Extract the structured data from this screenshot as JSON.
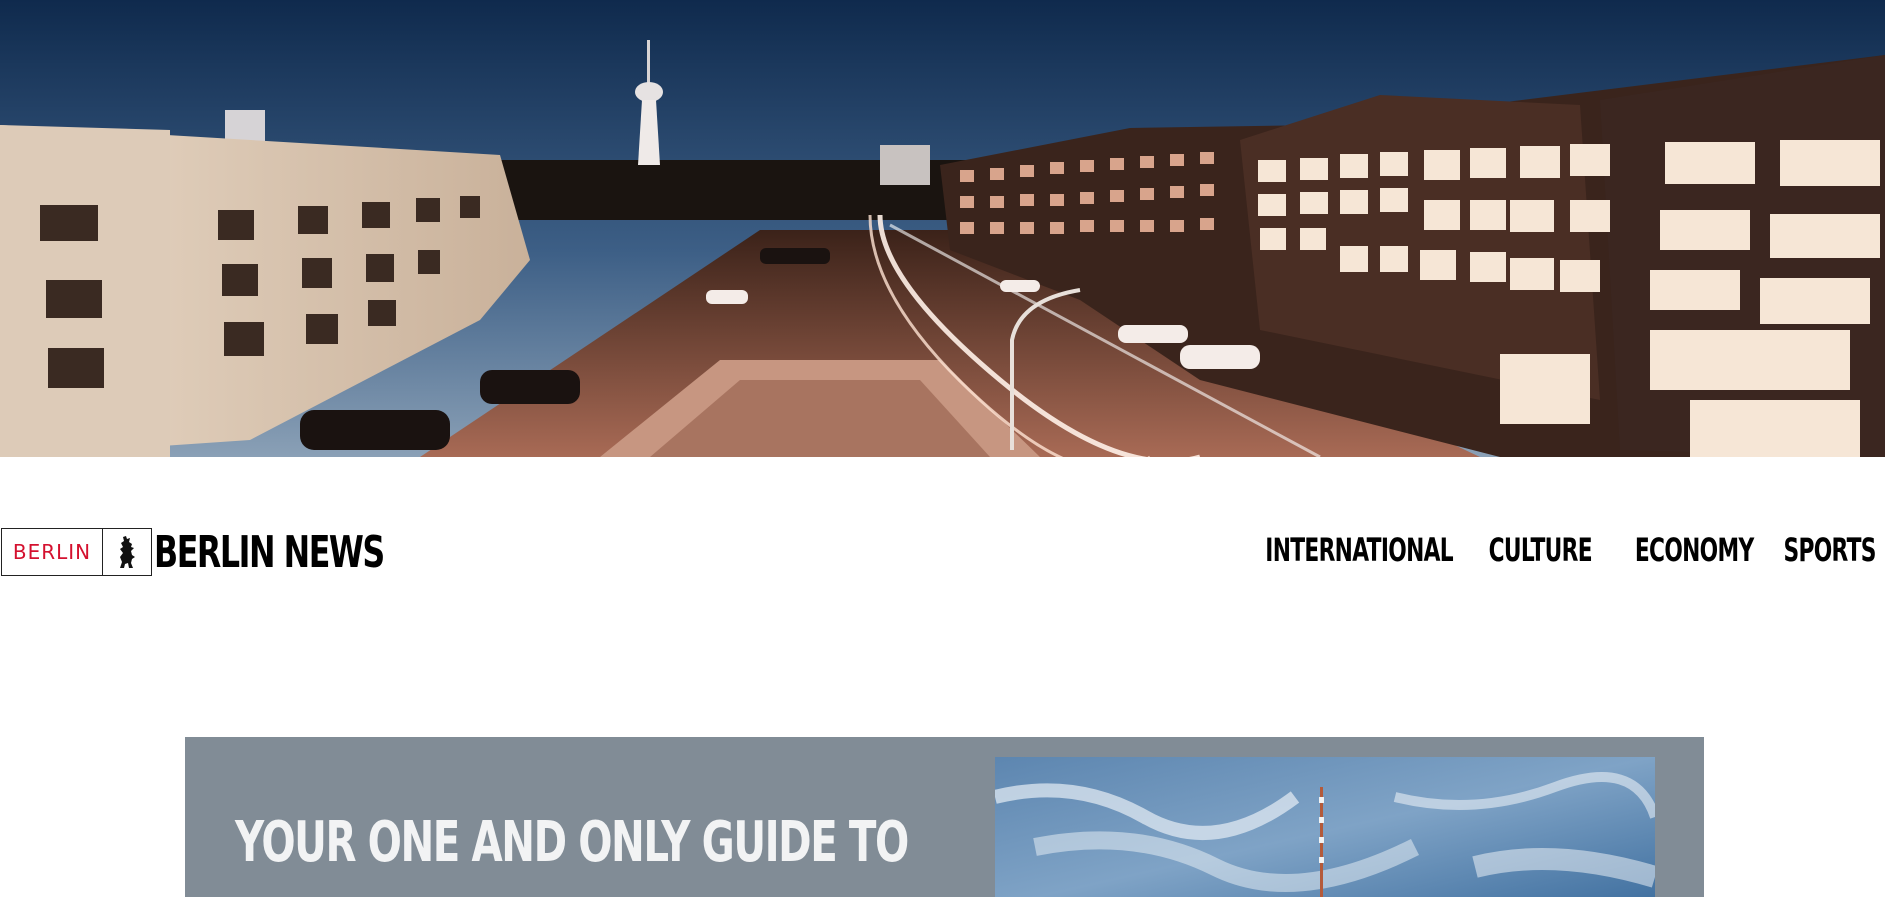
{
  "hero": {
    "image_description_icon": "berlin-street-night-photo"
  },
  "header": {
    "logo": {
      "word": "BERLIN",
      "icon": "berlin-bear-icon"
    },
    "site_title": "BERLIN NEWS",
    "nav": [
      {
        "label": "INTERNATIONAL"
      },
      {
        "label": "CULTURE"
      },
      {
        "label": "ECONOMY"
      },
      {
        "label": "SPORTS"
      }
    ]
  },
  "feature": {
    "heading": "YOUR ONE AND ONLY GUIDE TO",
    "image_icon": "tv-tower-sky-photo",
    "background_color": "#818c96"
  },
  "colors": {
    "logo_red": "#d4112f",
    "text": "#000000",
    "feature_bg": "#818c96"
  }
}
